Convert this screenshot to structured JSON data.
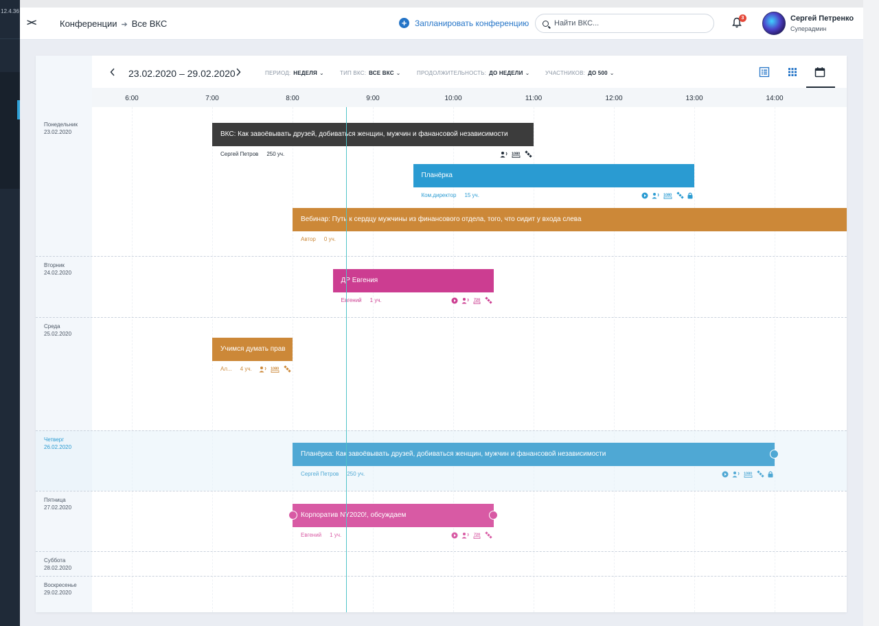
{
  "app": {
    "version": "12.4.36"
  },
  "header": {
    "collapse_label": "><",
    "breadcrumb": [
      "Конференции",
      "Все ВКС"
    ],
    "plan_button": "Запланировать конференцию",
    "search": {
      "placeholder": "Найти ВКС..."
    },
    "notifications": {
      "count": "3"
    },
    "user": {
      "name": "Сергей Петренко",
      "role": "Суперадмин"
    }
  },
  "toolbar": {
    "range": "23.02.2020 – 29.02.2020",
    "filters": [
      {
        "label": "ПЕРИОД:",
        "value": "НЕДЕЛЯ"
      },
      {
        "label": "ТИП ВКС:",
        "value": "ВСЕ ВКС"
      },
      {
        "label": "ПРОДОЛЖИТЕЛЬНОСТЬ:",
        "value": "ДО НЕДЕЛИ"
      },
      {
        "label": "УЧАСТНИКОВ:",
        "value": "ДО 500"
      }
    ],
    "views": [
      "list-view-icon",
      "grid-view-icon",
      "calendar-view-icon"
    ],
    "active_view": "calendar-view-icon"
  },
  "timeline": {
    "hours": [
      "6:00",
      "7:00",
      "8:00",
      "9:00",
      "10:00",
      "11:00",
      "12:00",
      "13:00",
      "14:00"
    ],
    "current_time": "8:40"
  },
  "days": [
    {
      "name": "Понедельник",
      "date": "23.02.2020"
    },
    {
      "name": "Вторник",
      "date": "24.02.2020"
    },
    {
      "name": "Среда",
      "date": "25.02.2020"
    },
    {
      "name": "Четверг",
      "date": "26.02.2020",
      "today": true
    },
    {
      "name": "Пятница",
      "date": "27.02.2020"
    },
    {
      "name": "Суббота",
      "date": "28.02.2020"
    },
    {
      "name": "Воскресенье",
      "date": "29.02.2020"
    }
  ],
  "colors": {
    "dark": "#3c3c3c",
    "blue": "#2a9bd2",
    "orange": "#cc8838",
    "pink": "#cc3d91",
    "today_blue": "#4fa8d4",
    "today_pink": "#d85aa4",
    "accent": "#2474c7"
  },
  "events": [
    {
      "title": "ВКС: Как завоёвывать друзей, добиваться женщин, мужчин и фанансовой независимости",
      "owner": "Сергей Петров",
      "participants": "250 уч.",
      "start": "7:00",
      "end": "11:00",
      "day": "23.02.2020",
      "color": "dark",
      "icons": [
        "speaker-icon",
        "1080p-icon",
        "satellite-icon"
      ]
    },
    {
      "title": "Планёрка",
      "owner": "Ком.директор",
      "participants": "15 уч.",
      "start": "9:30",
      "end": "13:00",
      "day": "23.02.2020",
      "color": "blue",
      "icons": [
        "play-icon",
        "speaker-icon",
        "1080p-icon",
        "satellite-icon",
        "lock-icon"
      ]
    },
    {
      "title": "Вебинар: Путь к сердцу мужчины из финансового отдела, того, что сидит у входа слева",
      "owner": "Автор",
      "participants": "0 уч.",
      "start": "8:00",
      "end": "14:55",
      "day": "23.02.2020",
      "color": "orange",
      "icons": []
    },
    {
      "title": "ДР Евгения",
      "owner": "Евгений",
      "participants": "1 уч.",
      "start": "8:30",
      "end": "10:30",
      "day": "24.02.2020",
      "color": "pink",
      "icons": [
        "play-icon",
        "speaker-icon",
        "720p-icon",
        "satellite-icon"
      ]
    },
    {
      "title": "Учимся думать прав",
      "owner": "Ал...",
      "participants": "4 уч.",
      "start": "7:00",
      "end": "8:00",
      "day": "25.02.2020",
      "color": "orange",
      "icons": [
        "speaker-icon",
        "1080p-icon",
        "satellite-icon"
      ]
    },
    {
      "title": "Планёрка: Как завоёвывать друзей, добиваться женщин, мужчин и фанансовой независимости",
      "owner": "Сергей Петров",
      "participants": "250 уч.",
      "start": "8:00",
      "end": "14:00",
      "day": "26.02.2020",
      "color": "today_blue",
      "icons": [
        "play-icon",
        "speaker-icon",
        "1080p-icon",
        "satellite-icon",
        "lock-icon"
      ]
    },
    {
      "title": "Корпоратив NY2020!, обсуждаем",
      "owner": "Евгений",
      "participants": "1 уч.",
      "start": "8:00",
      "end": "10:30",
      "day": "27.02.2020",
      "color": "today_pink",
      "icons": [
        "play-icon",
        "speaker-icon",
        "720p-icon",
        "satellite-icon"
      ]
    }
  ]
}
